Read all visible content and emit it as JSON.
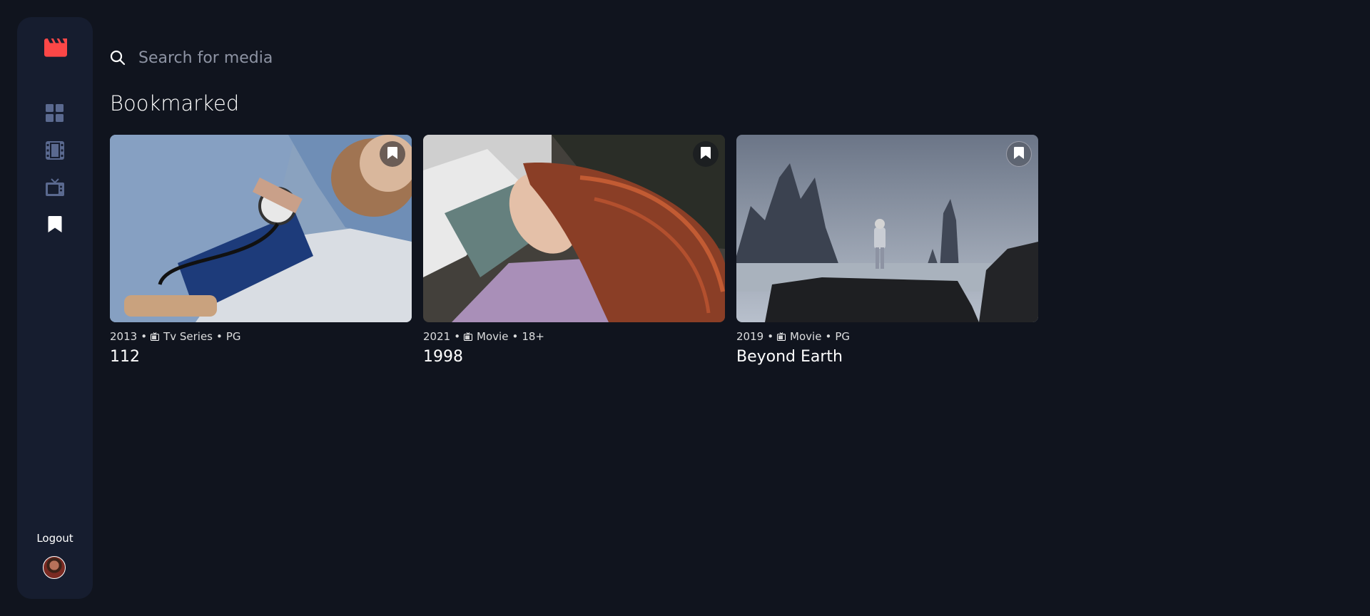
{
  "sidebar": {
    "nav": [
      {
        "id": "home",
        "icon": "grid-icon",
        "active": false
      },
      {
        "id": "movies",
        "icon": "film-icon",
        "active": false
      },
      {
        "id": "tv",
        "icon": "tv-icon",
        "active": false
      },
      {
        "id": "bookmarks",
        "icon": "bookmark-icon",
        "active": true
      }
    ],
    "logout_label": "Logout"
  },
  "search": {
    "placeholder": "Search for media",
    "value": ""
  },
  "section": {
    "title": "Bookmarked"
  },
  "cards": [
    {
      "year": "2013",
      "category": "Tv Series",
      "rating": "PG",
      "title": "112",
      "bookmarked": true
    },
    {
      "year": "2021",
      "category": "Movie",
      "rating": "18+",
      "title": "1998",
      "bookmarked": true
    },
    {
      "year": "2019",
      "category": "Movie",
      "rating": "PG",
      "title": "Beyond Earth",
      "bookmarked": true
    }
  ],
  "colors": {
    "background": "#10141E",
    "sidebar": "#161D2F",
    "accent": "#FC4747",
    "nav_inactive": "#5A698F",
    "white": "#FFFFFF"
  }
}
